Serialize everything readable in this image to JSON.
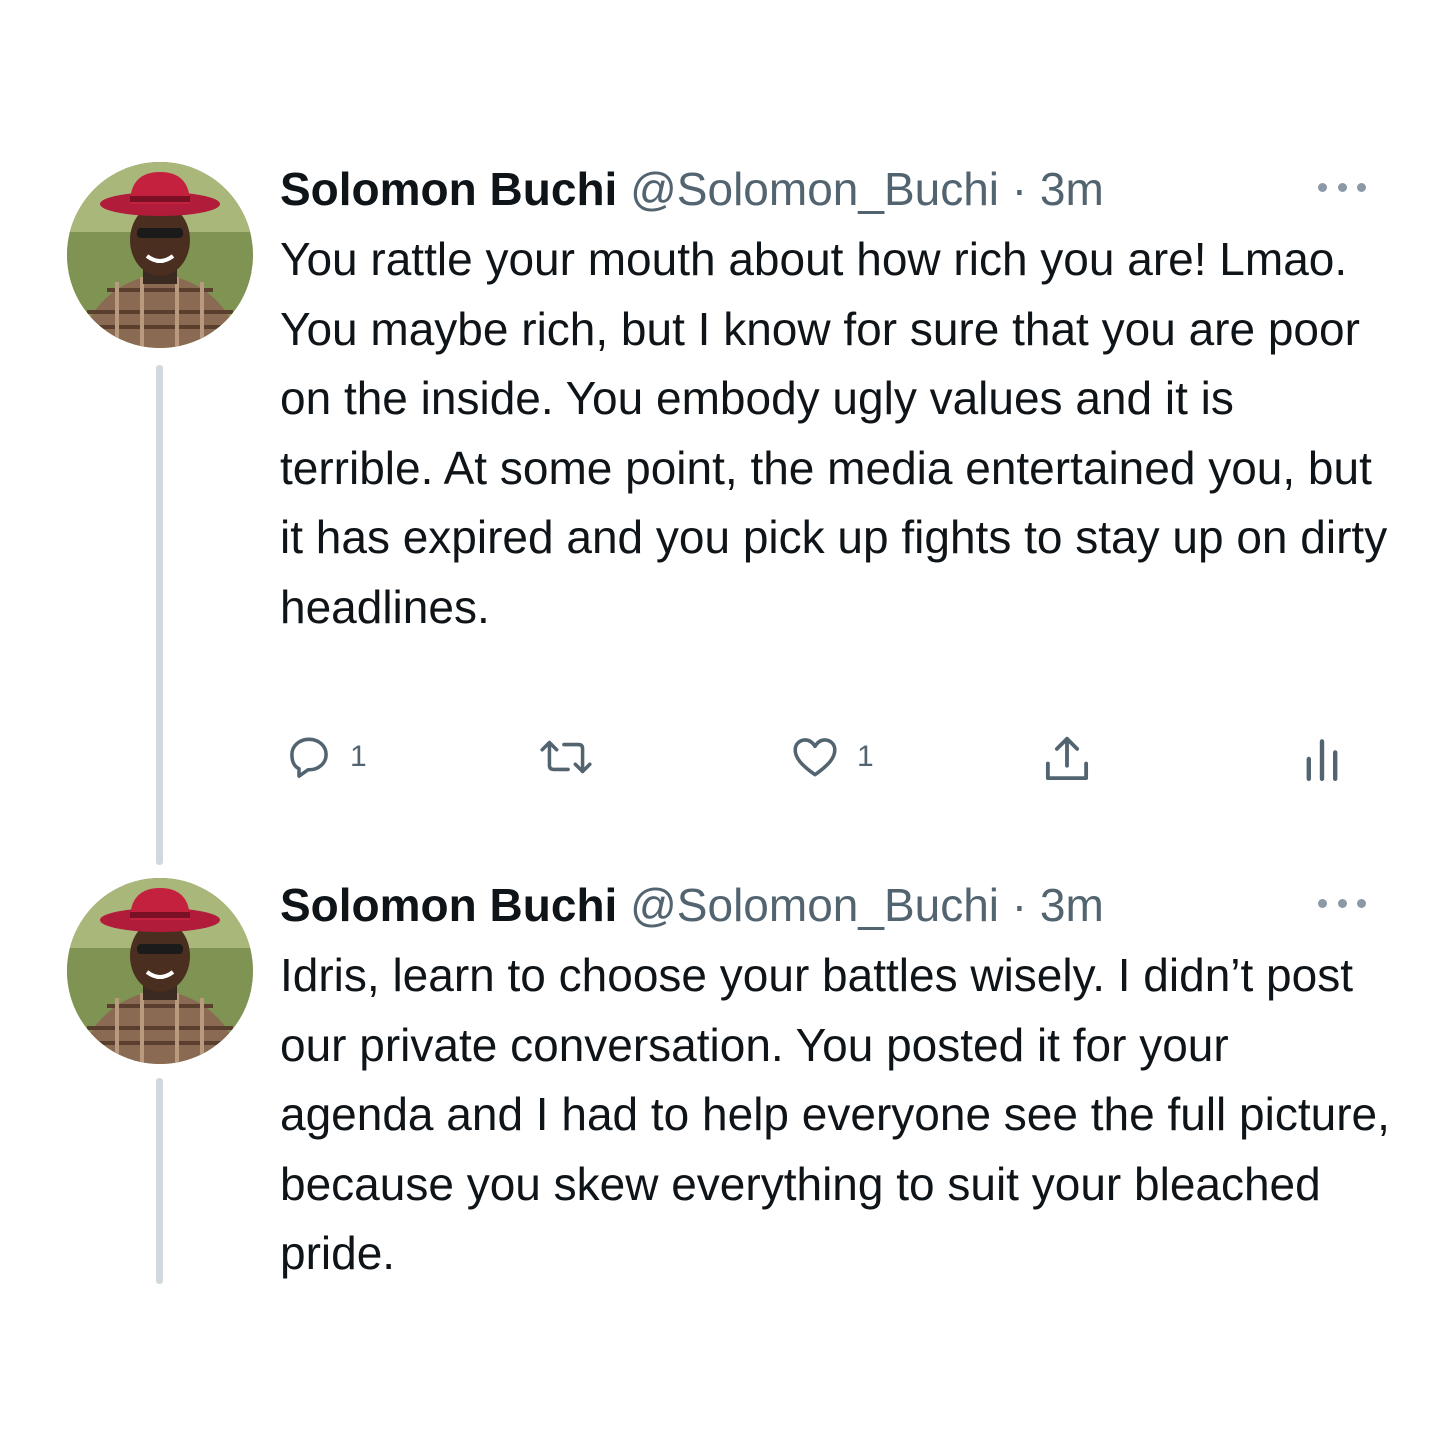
{
  "tweets": [
    {
      "author": {
        "name": "Solomon Buchi",
        "handle": "@Solomon_Buchi",
        "separator": "·",
        "time": "3m",
        "avatar_icon": "avatar-photo"
      },
      "text": "You rattle your mouth about how rich you are! Lmao. You maybe rich, but I know for sure that you are poor on the inside. You embody ugly values and it is terrible. At some point, the media entertained you, but it has expired and you pick up fights to stay up on dirty headlines.",
      "actions": {
        "reply_count": "1",
        "retweet_count": "",
        "like_count": "1",
        "icons": [
          "reply-icon",
          "retweet-icon",
          "like-icon",
          "share-icon",
          "analytics-icon"
        ]
      }
    },
    {
      "author": {
        "name": "Solomon Buchi",
        "handle": "@Solomon_Buchi",
        "separator": "·",
        "time": "3m",
        "avatar_icon": "avatar-photo"
      },
      "text": "Idris, learn to choose your battles wisely. I didn’t post our private conversation. You posted it for your agenda and I had to help everyone see the full picture, because you skew everything to suit your bleached pride."
    }
  ],
  "colors": {
    "text_primary": "#0f1419",
    "text_secondary": "#536471",
    "thread_line": "#cfd9de",
    "avatar_hat": "#c4213f"
  }
}
